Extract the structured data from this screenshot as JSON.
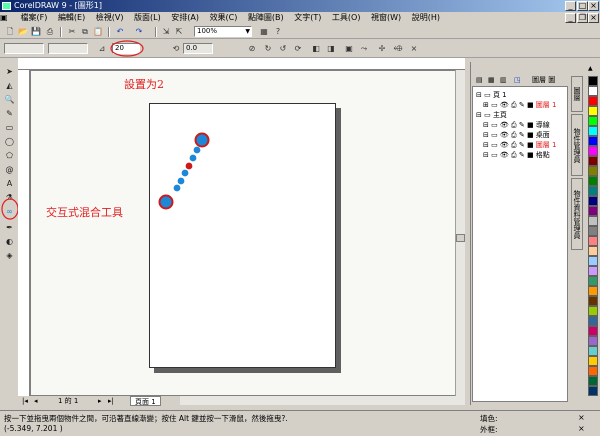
{
  "window": {
    "title": "CorelDRAW 9 - [圖形1]"
  },
  "menu": [
    "檔案(F)",
    "編輯(E)",
    "檢視(V)",
    "版面(L)",
    "安排(A)",
    "效果(C)",
    "點陣圖(B)",
    "文字(T)",
    "工具(O)",
    "視窗(W)",
    "說明(H)"
  ],
  "toolbar": {
    "zoom": "100%"
  },
  "propbar": {
    "steps": "20",
    "rotation": "0.0"
  },
  "annotations": {
    "set_label": "設置为2",
    "tool_label": "交互式混合工具"
  },
  "page_nav": {
    "counter": "1 的 1",
    "tab": "頁面 1"
  },
  "status": {
    "hint": "按一下並拖曳兩個物件之間，可沿著直線漸變；按住 Alt 鍵並按一下滑鼠，然後拖曳?.",
    "coords": "(-5.349, 7.201 )",
    "fill_label": "填色:",
    "outline_label": "外框:"
  },
  "docker": {
    "title": "圖層 圖",
    "tree": [
      {
        "label": "頁 1",
        "level": 0
      },
      {
        "label": "圖層 1",
        "level": 1,
        "color": "#e02020"
      },
      {
        "label": "主頁",
        "level": 0
      },
      {
        "label": "導線",
        "level": 1
      },
      {
        "label": "桌面",
        "level": 1
      },
      {
        "label": "圖層 1",
        "level": 1,
        "color": "#e02020"
      },
      {
        "label": "格點",
        "level": 1
      }
    ],
    "tabs": [
      "圖層",
      "物件管理員",
      "物件資料管理員"
    ]
  },
  "palette": [
    "#000000",
    "#ffffff",
    "#ff0000",
    "#ffff00",
    "#00ff00",
    "#00ffff",
    "#0000ff",
    "#ff00ff",
    "#800000",
    "#808000",
    "#008000",
    "#008080",
    "#000080",
    "#800080",
    "#c0c0c0",
    "#808080",
    "#ff8080",
    "#ffcc99",
    "#99ccff",
    "#cc99ff",
    "#339966",
    "#ff9900",
    "#663300",
    "#99cc00",
    "#336699",
    "#cc0066",
    "#9966cc",
    "#66cccc",
    "#ffcc00",
    "#ff6600",
    "#006633",
    "#003366"
  ],
  "colors": {
    "blend_blue": "#1e88d8",
    "blend_red": "#cc1a1a",
    "annot_red": "#e02020"
  }
}
